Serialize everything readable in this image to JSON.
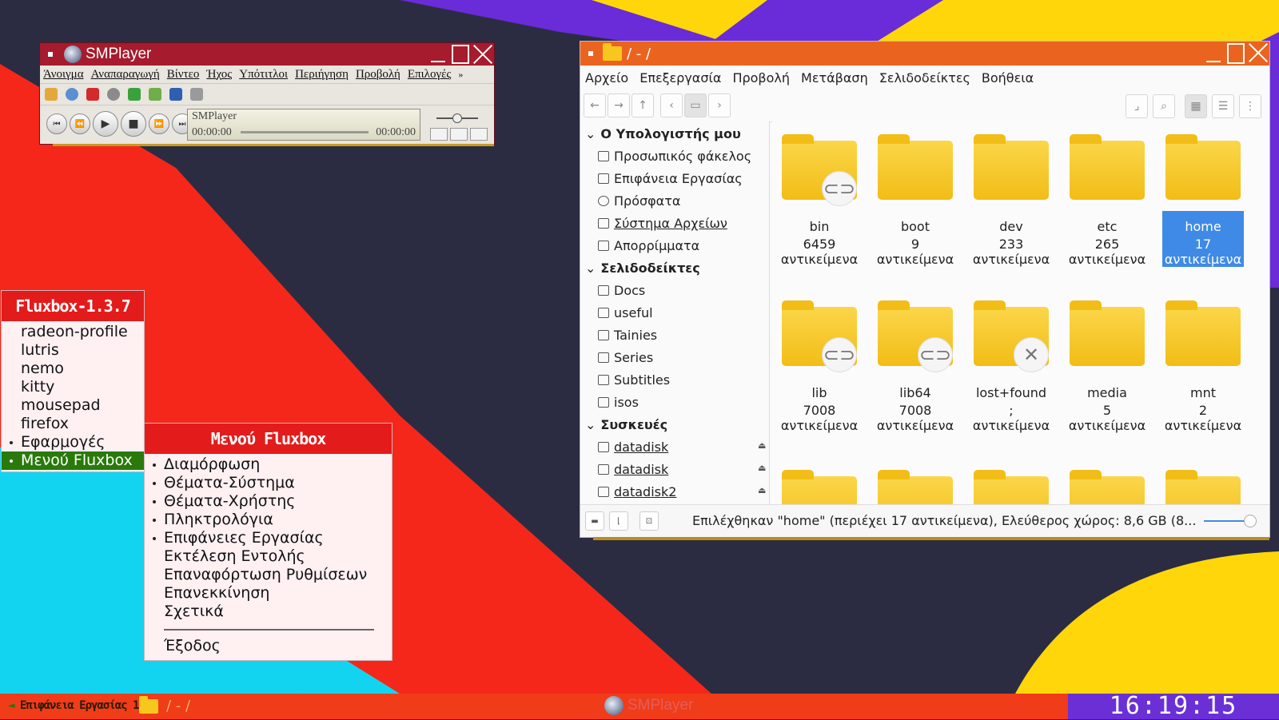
{
  "colors": {
    "accent_red": "#e41b1b",
    "fm_title": "#ea6420",
    "smp_title": "#a61b2d",
    "selection": "#3f8ae6",
    "menu_active": "#2a7a0b",
    "clock_bg": "#6b2fd6"
  },
  "smplayer": {
    "title": "SMPlayer",
    "menu": [
      "Άνοιγμα",
      "Αναπαραγωγή",
      "Βίντεο",
      "Ήχος",
      "Υπότιτλοι",
      "Περιήγηση",
      "Προβολή",
      "Επιλογές"
    ],
    "more": "»",
    "lcd_title": "SMPlayer",
    "time_current": "00:00:00",
    "time_total": "00:00:00"
  },
  "filemanager": {
    "title": "/ - /",
    "menu": [
      "Αρχείο",
      "Επεξεργασία",
      "Προβολή",
      "Μετάβαση",
      "Σελιδοδείκτες",
      "Βοήθεια"
    ],
    "sidebar": {
      "computer_title": "Ο Υπολογιστής μου",
      "computer": [
        "Προσωπικός φάκελος",
        "Επιφάνεια Εργασίας",
        "Πρόσφατα",
        "Σύστημα Αρχείων",
        "Απορρίμματα"
      ],
      "bookmarks_title": "Σελιδοδείκτες",
      "bookmarks": [
        "Docs",
        "useful",
        "Tainies",
        "Series",
        "Subtitles",
        "isos"
      ],
      "devices_title": "Συσκευές",
      "devices": [
        "datadisk",
        "datadisk",
        "datadisk2"
      ]
    },
    "items": [
      {
        "name": "bin",
        "count": "6459",
        "unit": "αντικείμενα",
        "badge": "link"
      },
      {
        "name": "boot",
        "count": "9",
        "unit": "αντικείμενα",
        "badge": ""
      },
      {
        "name": "dev",
        "count": "233",
        "unit": "αντικείμενα",
        "badge": ""
      },
      {
        "name": "etc",
        "count": "265",
        "unit": "αντικείμενα",
        "badge": ""
      },
      {
        "name": "home",
        "count": "17",
        "unit": "αντικείμενα",
        "badge": "",
        "selected": true
      },
      {
        "name": "lib",
        "count": "7008",
        "unit": "αντικείμενα",
        "badge": "link"
      },
      {
        "name": "lib64",
        "count": "7008",
        "unit": "αντικείμενα",
        "badge": "link"
      },
      {
        "name": "lost+found",
        "count": ";",
        "unit": "αντικείμενα",
        "badge": "x"
      },
      {
        "name": "media",
        "count": "5",
        "unit": "αντικείμενα",
        "badge": ""
      },
      {
        "name": "mnt",
        "count": "2",
        "unit": "αντικείμενα",
        "badge": ""
      }
    ],
    "status": "Επιλέχθηκαν \"home\" (περιέχει 17 αντικείμενα), Ελεύθερος χώρος: 8,6 GB (8..."
  },
  "fluxbox_menu": {
    "title": "Fluxbox-1.3.7",
    "items": [
      {
        "label": "radeon-profile",
        "sub": false
      },
      {
        "label": "lutris",
        "sub": false
      },
      {
        "label": "nemo",
        "sub": false
      },
      {
        "label": "kitty",
        "sub": false
      },
      {
        "label": "mousepad",
        "sub": false
      },
      {
        "label": "firefox",
        "sub": false
      },
      {
        "label": "Εφαρμογές",
        "sub": true
      },
      {
        "label": "Μενού Fluxbox",
        "sub": true,
        "active": true
      }
    ]
  },
  "fluxbox_submenu": {
    "title": "Μενού Fluxbox",
    "items": [
      {
        "label": "Διαμόρφωση",
        "sub": true
      },
      {
        "label": "Θέματα-Σύστημα",
        "sub": true
      },
      {
        "label": "Θέματα-Χρήστης",
        "sub": true
      },
      {
        "label": "Πληκτρολόγια",
        "sub": true
      },
      {
        "label": "Επιφάνειες Εργασίας",
        "sub": true
      },
      {
        "label": "Εκτέλεση Εντολής",
        "sub": false
      },
      {
        "label": "Επαναφόρτωση Ρυθμίσεων",
        "sub": false
      },
      {
        "label": "Επανεκκίνηση",
        "sub": false
      },
      {
        "label": "Σχετικά",
        "sub": false
      }
    ],
    "exit": "Έξοδος"
  },
  "taskbar": {
    "workspace": "Επιφάνεια Εργασίας 1",
    "left_arrow": "◄",
    "right_arrow": "►",
    "task_fm": "/ - /",
    "task_smp": "SMPlayer",
    "clock": "16:19:15"
  }
}
